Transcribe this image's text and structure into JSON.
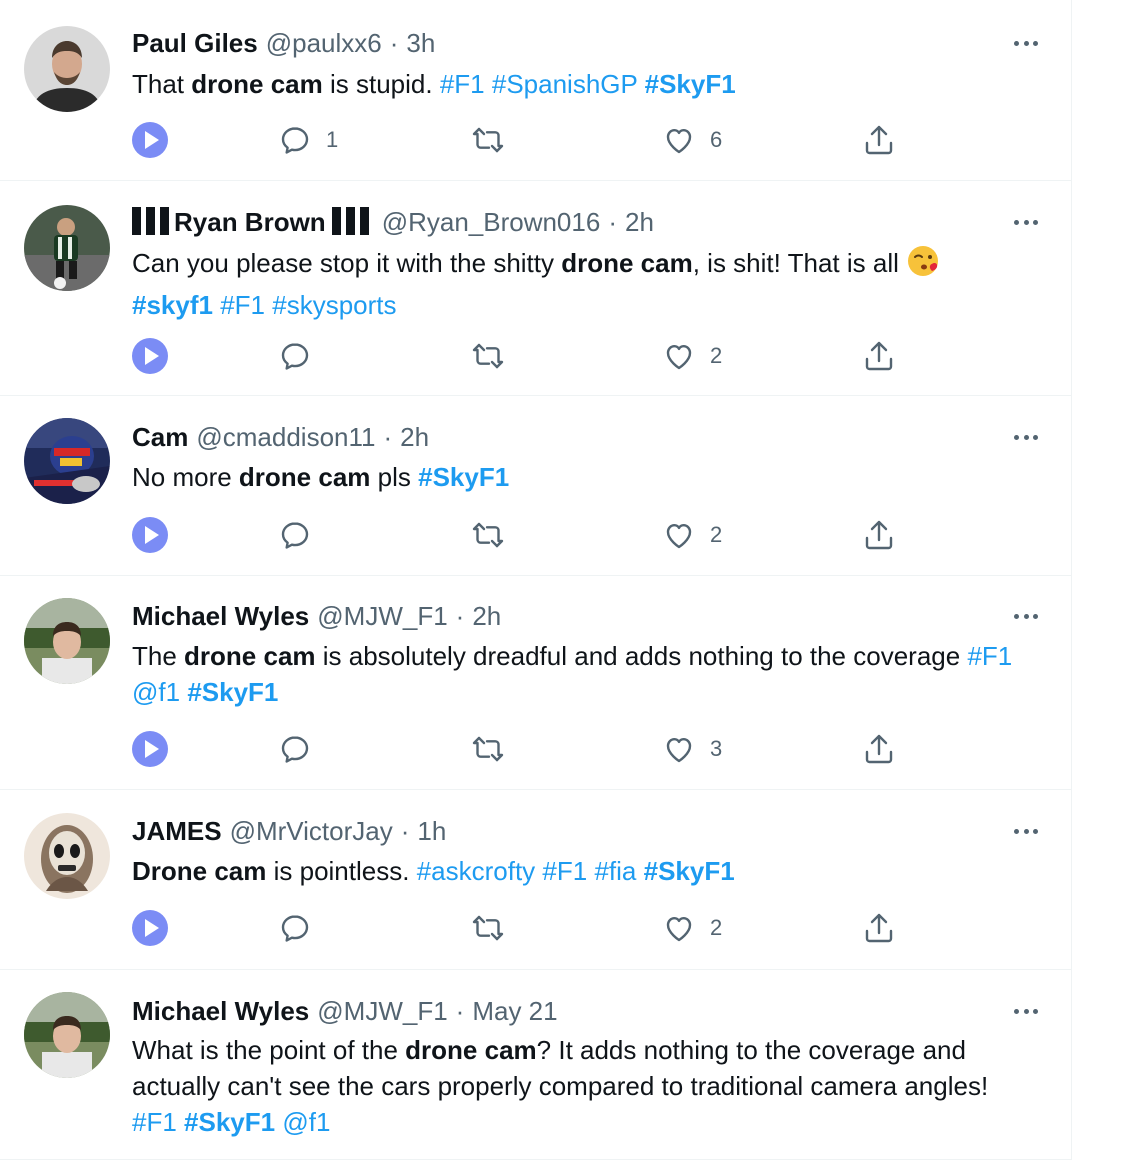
{
  "tweets": [
    {
      "name": "Paul Giles",
      "handle": "@paulxx6",
      "sep": "·",
      "time": "3h",
      "text_parts": [
        {
          "t": "That "
        },
        {
          "t": "drone cam",
          "bold": true
        },
        {
          "t": " is stupid. "
        },
        {
          "t": "#F1",
          "tag": true
        },
        {
          "t": " "
        },
        {
          "t": "#SpanishGP",
          "tag": true
        },
        {
          "t": " "
        },
        {
          "t": "#SkyF1",
          "tag": true,
          "bold": true
        }
      ],
      "replies": "1",
      "retweets": "",
      "likes": "6"
    },
    {
      "name": "Ryan Brown",
      "name_prefix_bars": 3,
      "name_suffix_bars": 3,
      "handle": "@Ryan_Brown016",
      "sep": "·",
      "time": "2h",
      "text_parts": [
        {
          "t": "Can you please stop it with the shitty "
        },
        {
          "t": "drone cam",
          "bold": true
        },
        {
          "t": ", is shit! That is all "
        },
        {
          "emoji": "kiss-face-emoji"
        },
        {
          "br": true
        },
        {
          "t": "#skyf1",
          "tag": true,
          "bold": true
        },
        {
          "t": " "
        },
        {
          "t": "#F1",
          "tag": true
        },
        {
          "t": " "
        },
        {
          "t": "#skysports",
          "tag": true
        }
      ],
      "replies": "",
      "retweets": "",
      "likes": "2"
    },
    {
      "name": "Cam",
      "handle": "@cmaddison11",
      "sep": "·",
      "time": "2h",
      "text_parts": [
        {
          "t": "No more "
        },
        {
          "t": "drone cam",
          "bold": true
        },
        {
          "t": " pls "
        },
        {
          "t": "#SkyF1",
          "tag": true,
          "bold": true
        }
      ],
      "replies": "",
      "retweets": "",
      "likes": "2"
    },
    {
      "name": "Michael Wyles",
      "handle": "@MJW_F1",
      "sep": "·",
      "time": "2h",
      "text_parts": [
        {
          "t": "The "
        },
        {
          "t": "drone cam",
          "bold": true
        },
        {
          "t": " is absolutely dreadful and adds nothing to the coverage "
        },
        {
          "t": "#F1",
          "tag": true
        },
        {
          "br": true
        },
        {
          "t": "@f1",
          "tag": true
        },
        {
          "t": " "
        },
        {
          "t": "#SkyF1",
          "tag": true,
          "bold": true
        }
      ],
      "replies": "",
      "retweets": "",
      "likes": "3"
    },
    {
      "name": "JAMES",
      "handle": "@MrVictorJay",
      "sep": "·",
      "time": "1h",
      "text_parts": [
        {
          "t": "Drone cam",
          "bold": true
        },
        {
          "t": " is pointless. "
        },
        {
          "t": "#askcrofty",
          "tag": true
        },
        {
          "t": " "
        },
        {
          "t": "#F1",
          "tag": true
        },
        {
          "t": " "
        },
        {
          "t": "#fia",
          "tag": true
        },
        {
          "t": " "
        },
        {
          "t": "#SkyF1",
          "tag": true,
          "bold": true
        }
      ],
      "replies": "",
      "retweets": "",
      "likes": "2"
    },
    {
      "name": "Michael Wyles",
      "handle": "@MJW_F1",
      "sep": "·",
      "time": "May 21",
      "text_parts": [
        {
          "t": "What is the point of the "
        },
        {
          "t": "drone cam",
          "bold": true
        },
        {
          "t": "? It adds nothing to the coverage and"
        },
        {
          "br": true
        },
        {
          "t": "actually can't see the cars properly compared to traditional camera angles!"
        },
        {
          "br": true
        },
        {
          "t": "#F1",
          "tag": true
        },
        {
          "t": " "
        },
        {
          "t": "#SkyF1",
          "tag": true,
          "bold": true
        },
        {
          "t": " "
        },
        {
          "t": "@f1",
          "tag": true
        }
      ],
      "replies": "",
      "retweets": "",
      "likes": ""
    }
  ],
  "icons": {
    "play": "play-icon",
    "reply": "reply-icon",
    "retweet": "retweet-icon",
    "like": "heart-icon",
    "share": "share-icon",
    "more": "more-icon"
  },
  "colors": {
    "hashtag": "#1d9bf0",
    "play_button": "#7b8cf5",
    "secondary_text": "#536471"
  }
}
